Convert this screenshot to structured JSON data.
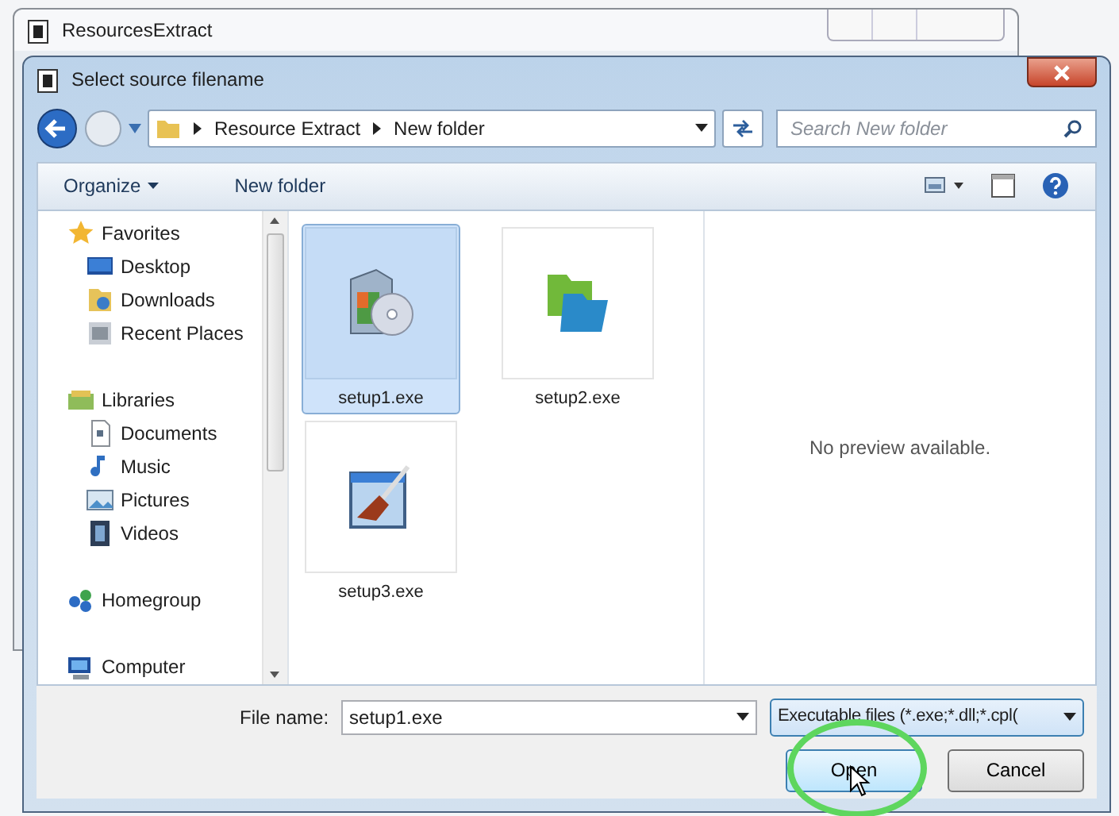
{
  "background_window": {
    "title": "ResourcesExtract"
  },
  "dialog": {
    "title": "Select source filename",
    "breadcrumb": [
      "Resource Extract",
      "New folder"
    ],
    "search": {
      "placeholder": "Search New folder"
    },
    "toolbar": [
      {
        "label": "Organize",
        "kind": "menu"
      },
      {
        "label": "New folder",
        "kind": "button"
      }
    ],
    "navigation": [
      {
        "label": "Favorites",
        "children": [
          {
            "label": "Desktop"
          },
          {
            "label": "Downloads"
          },
          {
            "label": "Recent Places"
          }
        ]
      },
      {
        "label": "Libraries",
        "children": [
          {
            "label": "Documents"
          },
          {
            "label": "Music"
          },
          {
            "label": "Pictures"
          },
          {
            "label": "Videos"
          }
        ]
      },
      {
        "label": "Homegroup"
      },
      {
        "label": "Computer"
      }
    ],
    "files": [
      {
        "name": "setup1.exe",
        "selected": true
      },
      {
        "name": "setup2.exe",
        "selected": false
      },
      {
        "name": "setup3.exe",
        "selected": false
      }
    ],
    "preview": {
      "message": "No preview available."
    },
    "file_name": {
      "label": "File name:",
      "value": "setup1.exe"
    },
    "file_type": {
      "value": "Executable files (*.exe;*.dll;*.cpl("
    },
    "buttons": [
      {
        "label": "Open",
        "kind": "default"
      },
      {
        "label": "Cancel",
        "kind": "normal"
      }
    ]
  }
}
